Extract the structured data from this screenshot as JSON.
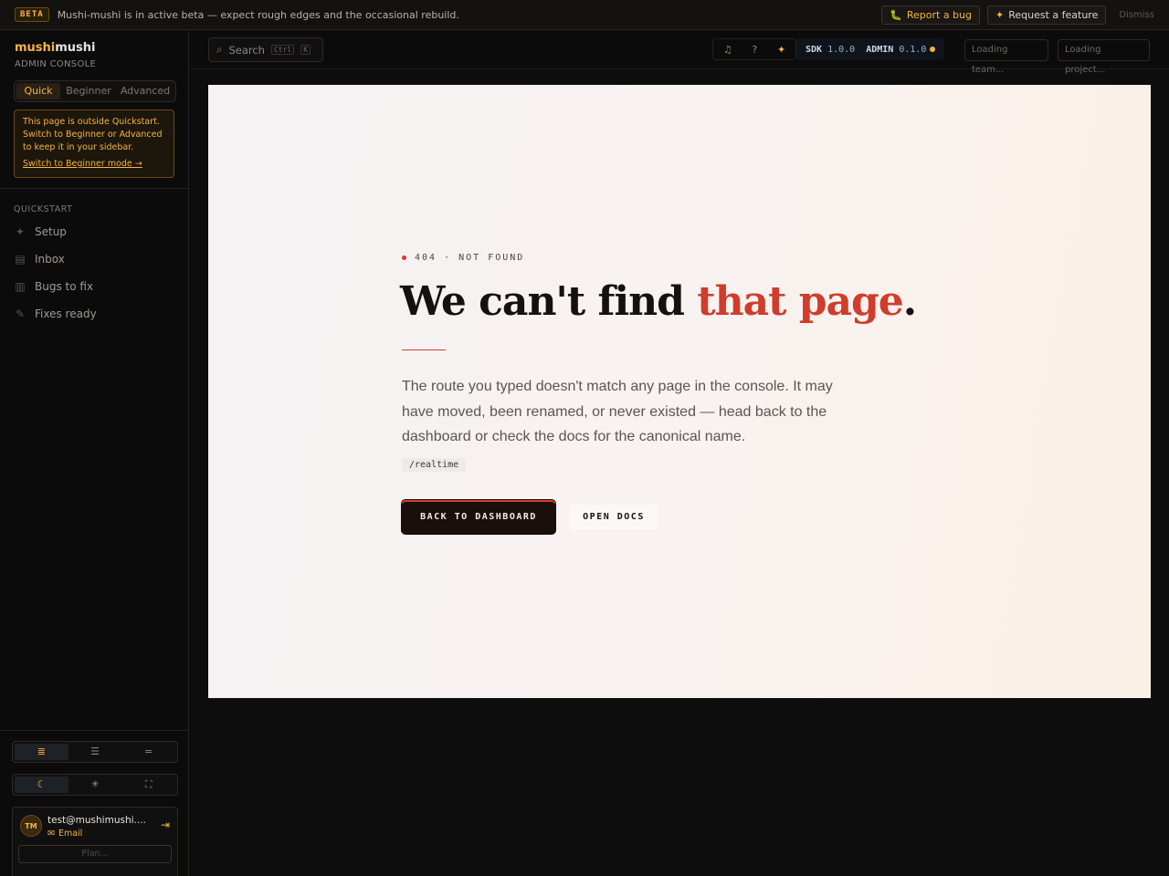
{
  "banner": {
    "badge": "BETA",
    "text": "Mushi-mushi is in active beta — expect rough edges and the occasional rebuild.",
    "report_bug": "Report a bug",
    "request_feature": "Request a feature",
    "dismiss": "Dismiss"
  },
  "brand": {
    "part1": "mushi",
    "part2": "mushi",
    "subtitle": "ADMIN CONSOLE"
  },
  "modes": [
    "Quick",
    "Beginner",
    "Advanced"
  ],
  "warning": {
    "text": "This page is outside Quickstart. Switch to Beginner or Advanced to keep it in your sidebar.",
    "link": "Switch to Beginner mode →"
  },
  "sidebar": {
    "section": "QUICKSTART",
    "items": [
      {
        "label": "Setup",
        "icon": "sparkle-icon"
      },
      {
        "label": "Inbox",
        "icon": "inbox-icon"
      },
      {
        "label": "Bugs to fix",
        "icon": "document-icon"
      },
      {
        "label": "Fixes ready",
        "icon": "wrench-icon"
      }
    ]
  },
  "user": {
    "initials": "TM",
    "email": "test@mushimushi....",
    "method": "Email",
    "plan": "Plan..."
  },
  "topbar": {
    "search_placeholder": "Search",
    "shortcut_mod": "Ctrl",
    "shortcut_key": "K",
    "sdk_label": "SDK",
    "sdk_version": "1.0.0",
    "admin_label": "ADMIN",
    "admin_version": "0.1.0",
    "team_loading": "Loading team...",
    "project_loading": "Loading project..."
  },
  "notfound": {
    "eyebrow": "404 · NOT FOUND",
    "headline_plain": "We can't find ",
    "headline_accent": "that page",
    "headline_end": ".",
    "description": "The route you typed doesn't match any page in the console. It may have moved, been renamed, or never existed — head back to the dashboard or check the docs for the canonical name.",
    "route": "/realtime",
    "primary_button": "BACK TO DASHBOARD",
    "secondary_button": "OPEN DOCS"
  },
  "colors": {
    "accent": "#f5b544",
    "danger": "#d03d2c",
    "panel_bg": "#f7f1f1"
  }
}
